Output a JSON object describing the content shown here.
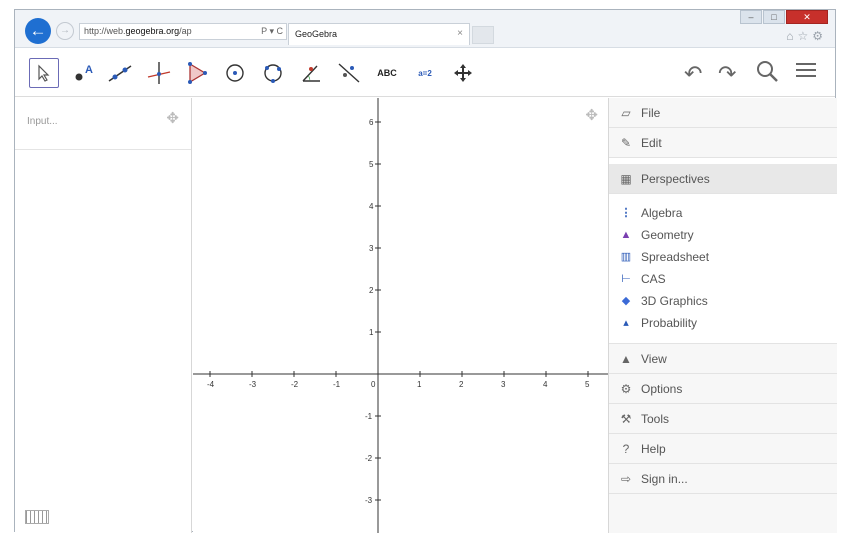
{
  "browser": {
    "address_prefix": "http://web.",
    "address_host": "geogebra.org",
    "address_suffix": "/ap",
    "address_controls": "Ρ ▾ C",
    "tab_title": "GeoGebra",
    "tab_close": "×"
  },
  "toolbar": {
    "text_tool_label": "ABC",
    "slider_tool_label": "a=2"
  },
  "algebra": {
    "input_placeholder": "Input..."
  },
  "graph": {
    "x_ticks": [
      "-4",
      "-3",
      "-2",
      "-1",
      "0",
      "1",
      "2",
      "3",
      "4",
      "5"
    ],
    "y_ticks": [
      "6",
      "5",
      "4",
      "3",
      "2",
      "1",
      "-1",
      "-2",
      "-3"
    ]
  },
  "menu": {
    "items": [
      {
        "label": "File",
        "icon": "folder-icon"
      },
      {
        "label": "Edit",
        "icon": "pencil-icon"
      },
      {
        "label": "Perspectives",
        "icon": "perspectives-icon"
      },
      {
        "label": "View",
        "icon": "view-icon"
      },
      {
        "label": "Options",
        "icon": "gear-icon"
      },
      {
        "label": "Tools",
        "icon": "tools-icon"
      },
      {
        "label": "Help",
        "icon": "help-icon"
      },
      {
        "label": "Sign in...",
        "icon": "sign-in-icon"
      }
    ],
    "perspectives": [
      {
        "label": "Algebra",
        "icon": "algebra-icon",
        "color": "#2b5ab7"
      },
      {
        "label": "Geometry",
        "icon": "geometry-icon",
        "color": "#7a3fb0"
      },
      {
        "label": "Spreadsheet",
        "icon": "spreadsheet-icon",
        "color": "#2b5ab7"
      },
      {
        "label": "CAS",
        "icon": "cas-icon",
        "color": "#2b5ab7"
      },
      {
        "label": "3D Graphics",
        "icon": "3d-graphics-icon",
        "color": "#3b6ad6"
      },
      {
        "label": "Probability",
        "icon": "probability-icon",
        "color": "#2b5ab7"
      }
    ]
  }
}
